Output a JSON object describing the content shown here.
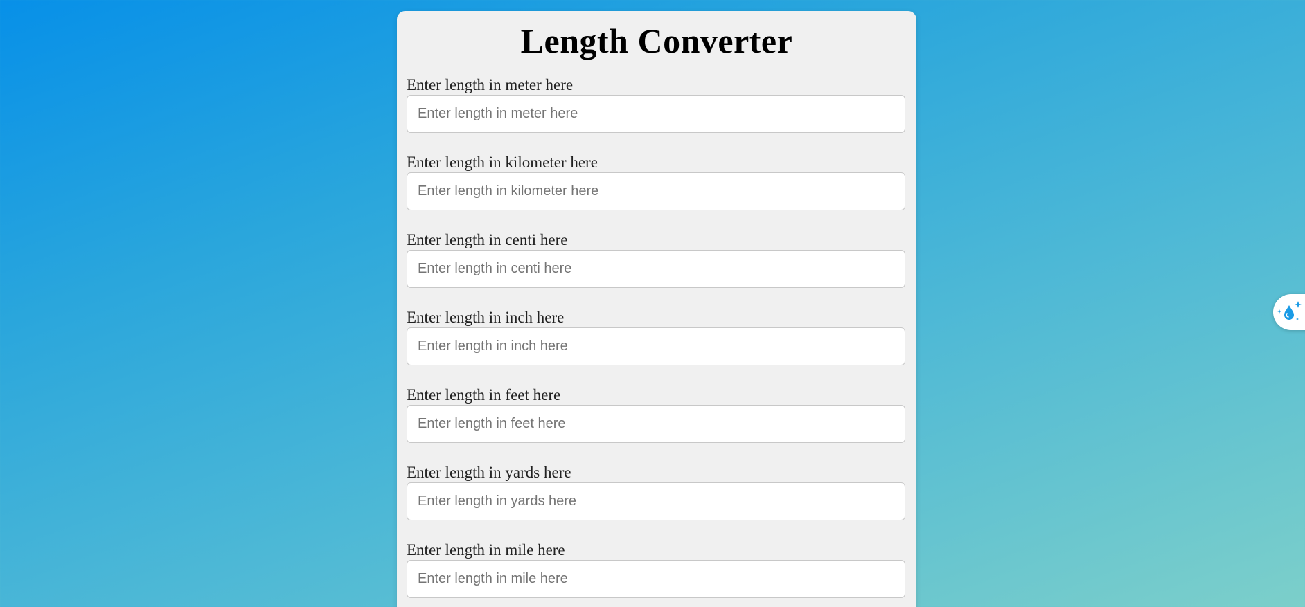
{
  "app": {
    "title": "Length Converter"
  },
  "fields": [
    {
      "label": "Enter length in meter here",
      "placeholder": "Enter length in meter here",
      "value": ""
    },
    {
      "label": "Enter length in kilometer here",
      "placeholder": "Enter length in kilometer here",
      "value": ""
    },
    {
      "label": "Enter length in centi here",
      "placeholder": "Enter length in centi here",
      "value": ""
    },
    {
      "label": "Enter length in inch here",
      "placeholder": "Enter length in inch here",
      "value": ""
    },
    {
      "label": "Enter length in feet here",
      "placeholder": "Enter length in feet here",
      "value": ""
    },
    {
      "label": "Enter length in yards here",
      "placeholder": "Enter length in yards here",
      "value": ""
    },
    {
      "label": "Enter length in mile here",
      "placeholder": "Enter length in mile here",
      "value": ""
    }
  ],
  "floating_button": {
    "icon": "droplet-sparkle-icon"
  },
  "colors": {
    "background_start": "#0790e8",
    "background_end": "#7ccfca",
    "card": "#f0f0f0",
    "accent_icon": "#1a9be6"
  }
}
